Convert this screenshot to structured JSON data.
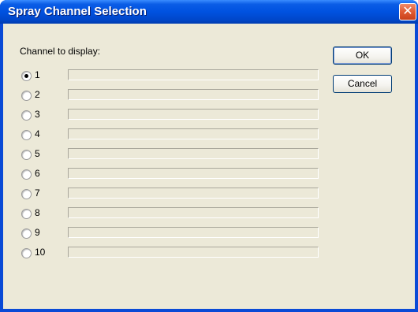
{
  "window": {
    "title": "Spray Channel Selection",
    "close_glyph": "✕",
    "titlebar_color": "#0052e0",
    "background_color": "#ece9d8"
  },
  "caption": "Channel to display:",
  "channels": [
    {
      "label": "1",
      "selected": true
    },
    {
      "label": "2",
      "selected": false
    },
    {
      "label": "3",
      "selected": false
    },
    {
      "label": "4",
      "selected": false
    },
    {
      "label": "5",
      "selected": false
    },
    {
      "label": "6",
      "selected": false
    },
    {
      "label": "7",
      "selected": false
    },
    {
      "label": "8",
      "selected": false
    },
    {
      "label": "9",
      "selected": false
    },
    {
      "label": "10",
      "selected": false
    }
  ],
  "buttons": {
    "ok_label": "OK",
    "cancel_label": "Cancel"
  }
}
